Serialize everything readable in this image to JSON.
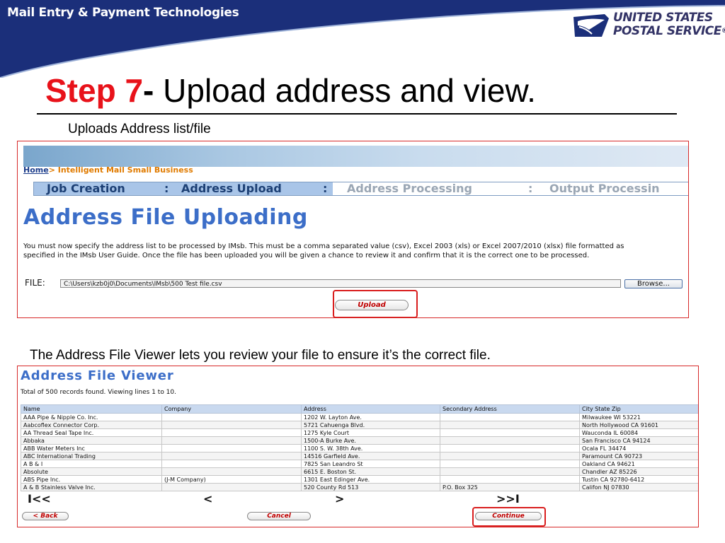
{
  "header": {
    "title": "Mail Entry & Payment Technologies",
    "logo_line1": "UNITED STATES",
    "logo_line2": "POSTAL SERVICE",
    "logo_mark": "®",
    "band_color": "#1b2f7a"
  },
  "slide": {
    "step_label": "Step 7",
    "step_dash": "-",
    "step_title": " Upload address and view.",
    "subtitle1": "Uploads Address list/file",
    "subtitle2": "The Address File Viewer lets you review your file to ensure it’s the correct file."
  },
  "upload_screen": {
    "breadcrumb_home": "Home",
    "breadcrumb_rest": "> Intelligent Mail Small Business",
    "steps": [
      "Job Creation",
      ":",
      "Address Upload",
      ":",
      "Address Processing",
      ":",
      "Output Processin"
    ],
    "heading": "Address File Uploading",
    "instructions": "You must now specify the address list to be processed by IMsb. This must be a comma separated value (csv), Excel 2003 (xls) or Excel 2007/2010 (xlsx) file formatted as specified in the IMsb User Guide. Once the file has been uploaded you will be given a chance to review it and confirm that it is the correct one to be processed.",
    "file_label": "FILE:",
    "file_value": "C:\\Users\\kzb0j0\\Documents\\IMsb\\500 Test file.csv",
    "browse_label": "Browse...",
    "upload_label": "Upload"
  },
  "viewer_screen": {
    "heading": "Address File Viewer",
    "summary": "Total of 500 records found. Viewing lines 1 to 10.",
    "columns": [
      "Name",
      "Company",
      "Address",
      "Secondary Address",
      "City State Zip"
    ],
    "rows": [
      [
        "AAA Pipe & Nipple Co. Inc.",
        "",
        "1202 W. Layton Ave.",
        "",
        "Milwaukee WI 53221"
      ],
      [
        "Aabcoflex Connector Corp.",
        "",
        "5721 Cahuenga Blvd.",
        "",
        "North Hollywood CA 91601"
      ],
      [
        "AA Thread Seal Tape Inc.",
        "",
        "1275 Kyle Court",
        "",
        "Wauconda IL 60084"
      ],
      [
        "Abbaka",
        "",
        "1500-A Burke Ave.",
        "",
        "San Francisco CA 94124"
      ],
      [
        "ABB Water Meters Inc",
        "",
        "1100 S. W. 38th Ave.",
        "",
        "Ocala FL 34474"
      ],
      [
        "ABC International Trading",
        "",
        "14516 Garfield Ave.",
        "",
        "Paramount CA 90723"
      ],
      [
        "A B & I",
        "",
        "7825 San Leandro St",
        "",
        "Oakland CA 94621"
      ],
      [
        "Absolute",
        "",
        "6615 E. Boston St.",
        "",
        "Chandler AZ 85226"
      ],
      [
        "ABS Pipe Inc.",
        "(J-M Company)",
        "1301 East Edinger Ave.",
        "",
        "Tustin CA 92780-6412"
      ],
      [
        "A & B Stainless Valve Inc.",
        "",
        "520 County Rd 513",
        "P.O. Box 325",
        "Califon NJ 07830"
      ]
    ],
    "nav_first": "I<<",
    "nav_prev": "<",
    "nav_next": ">",
    "nav_last": ">>I",
    "back_label": "< Back",
    "cancel_label": "Cancel",
    "continue_label": "Continue"
  }
}
